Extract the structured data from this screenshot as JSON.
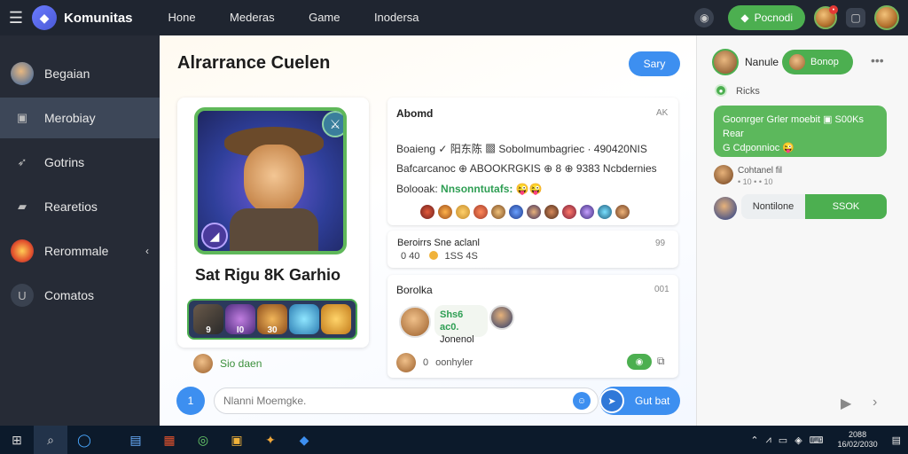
{
  "topbar": {
    "brand": "Komunitas",
    "nav": [
      "Hone",
      "Mederas",
      "Game",
      "Inodersa"
    ],
    "action_pill": "Pocnodi"
  },
  "sidebar": {
    "items": [
      {
        "label": "Begaian",
        "icon": "avatar-icon",
        "active": false
      },
      {
        "label": "Merobiay",
        "icon": "square-icon",
        "active": true
      },
      {
        "label": "Gotrins",
        "icon": "rocket-icon",
        "active": false
      },
      {
        "label": "Rearetios",
        "icon": "chat-icon",
        "active": false
      },
      {
        "label": "Rerommale",
        "icon": "hero-icon",
        "active": false
      },
      {
        "label": "Comatos",
        "icon": "u-icon",
        "active": false
      }
    ]
  },
  "main": {
    "title": "Alrarrance Cuelen",
    "story_button": "Sary",
    "hero": {
      "name": "Sat Rigu 8K Garhio",
      "strip_numbers": [
        "9",
        "I0",
        "30",
        "",
        ""
      ],
      "footer_label": "Sio daen"
    },
    "card1": {
      "title": "Abomd",
      "meta": "AK",
      "line1": "Boaieng ✓ 阳东陈 ▩ Sobolmumbagriec · 490420NIS",
      "line2": "Bafcarcanoc ⊕ ABOOKRGKIS ⊕ 8 ⊕ 9383 Ncbdernies",
      "line3_label": "Bolooak:",
      "line3_link": "Nnsonntutafs:",
      "line3_emoji": "😜😜"
    },
    "card2": {
      "title": "Beroirrs Sne aclanl",
      "meta": "99",
      "sub_left": "0 40",
      "sub_right": "1SS 4S"
    },
    "card3": {
      "title": "Borolka",
      "meta": "001",
      "bubble_green": "Shs6 ac0.",
      "bubble_line": "Jonenol",
      "footer_label": "oonhyler",
      "footer_prefix": "0"
    },
    "composer": {
      "placeholder": "Nlanni Moemgke.",
      "send_label": "Gut bat",
      "left_button": "1"
    }
  },
  "rpanel": {
    "user_name": "Nanule",
    "pill_label": "Bonop",
    "more": "•••",
    "status": "Ricks",
    "bubble_lines": [
      "Goonrger Grler moebit ▣ S00Ks",
      "Rear",
      "G Cdponnioc 😜"
    ],
    "row1": {
      "line1": "Cohtanel fil",
      "line2": "• 10 • • 10"
    },
    "split_left": "Nontilone",
    "split_right": "SSOK"
  },
  "taskbar": {
    "clock_time": "2088",
    "clock_date": "16/02/2030"
  }
}
